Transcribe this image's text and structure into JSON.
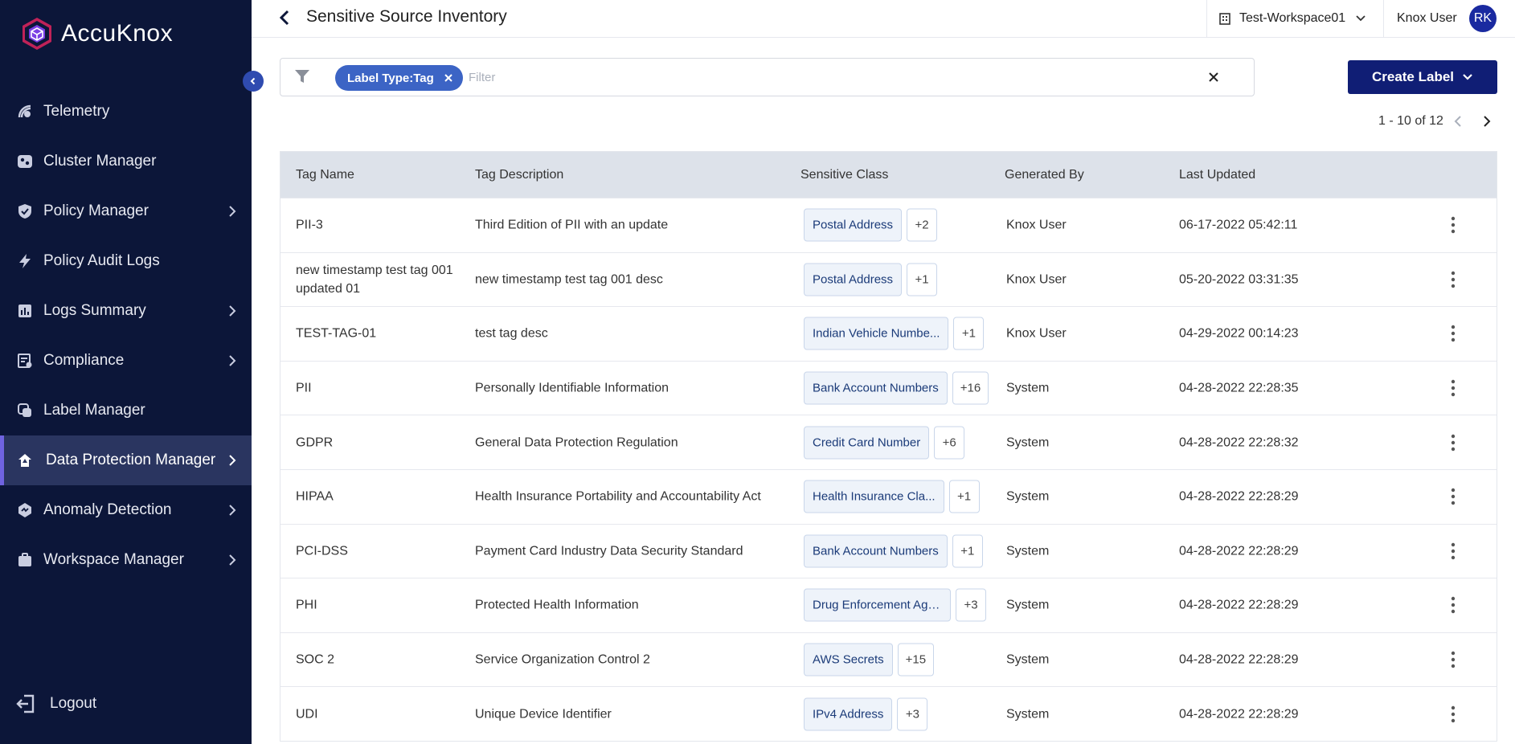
{
  "brand": {
    "name": "AccuKnox"
  },
  "sidebar": {
    "items": [
      {
        "label": "Telemetry",
        "icon": "telemetry-icon",
        "has_submenu": false,
        "active": false
      },
      {
        "label": "Cluster Manager",
        "icon": "cluster-icon",
        "has_submenu": false,
        "active": false
      },
      {
        "label": "Policy Manager",
        "icon": "shield-icon",
        "has_submenu": true,
        "active": false
      },
      {
        "label": "Policy Audit Logs",
        "icon": "bolt-icon",
        "has_submenu": false,
        "active": false
      },
      {
        "label": "Logs Summary",
        "icon": "bar-chart-icon",
        "has_submenu": true,
        "active": false
      },
      {
        "label": "Compliance",
        "icon": "compliance-icon",
        "has_submenu": true,
        "active": false
      },
      {
        "label": "Label Manager",
        "icon": "label-icon",
        "has_submenu": false,
        "active": false
      },
      {
        "label": "Data Protection Manager",
        "icon": "data-protection-icon",
        "has_submenu": true,
        "active": true
      },
      {
        "label": "Anomaly Detection",
        "icon": "anomaly-icon",
        "has_submenu": true,
        "active": false
      },
      {
        "label": "Workspace Manager",
        "icon": "briefcase-icon",
        "has_submenu": true,
        "active": false
      }
    ],
    "logout_label": "Logout"
  },
  "header": {
    "title": "Sensitive Source Inventory",
    "workspace": "Test-Workspace01",
    "user_name": "Knox User",
    "avatar_initials": "RK"
  },
  "filter": {
    "chip_label": "Label Type:Tag",
    "placeholder": "Filter",
    "value": ""
  },
  "create_button": {
    "label": "Create Label"
  },
  "pagination": {
    "summary": "1 - 10 of 12"
  },
  "table": {
    "columns": [
      "Tag Name",
      "Tag Description",
      "Sensitive Class",
      "Generated By",
      "Last Updated"
    ],
    "rows": [
      {
        "name": "PII-3",
        "description": "Third Edition of PII with an update",
        "class": "Postal Address",
        "more": "+2",
        "generated_by": "Knox User",
        "updated": "06-17-2022 05:42:11"
      },
      {
        "name": "new timestamp test tag 001 updated 01",
        "description": "new timestamp test tag 001 desc",
        "class": "Postal Address",
        "more": "+1",
        "generated_by": "Knox User",
        "updated": "05-20-2022 03:31:35"
      },
      {
        "name": "TEST-TAG-01",
        "description": "test tag desc",
        "class": "Indian Vehicle Numbe...",
        "more": "+1",
        "generated_by": "Knox User",
        "updated": "04-29-2022 00:14:23"
      },
      {
        "name": "PII",
        "description": "Personally Identifiable Information",
        "class": "Bank Account Numbers",
        "more": "+16",
        "generated_by": "System",
        "updated": "04-28-2022 22:28:35"
      },
      {
        "name": "GDPR",
        "description": "General Data Protection Regulation",
        "class": "Credit Card Number",
        "more": "+6",
        "generated_by": "System",
        "updated": "04-28-2022 22:28:32"
      },
      {
        "name": "HIPAA",
        "description": "Health Insurance Portability and Accountability Act",
        "class": "Health Insurance Cla...",
        "more": "+1",
        "generated_by": "System",
        "updated": "04-28-2022 22:28:29"
      },
      {
        "name": "PCI-DSS",
        "description": "Payment Card Industry Data Security Standard",
        "class": "Bank Account Numbers",
        "more": "+1",
        "generated_by": "System",
        "updated": "04-28-2022 22:28:29"
      },
      {
        "name": "PHI",
        "description": "Protected Health Information",
        "class": "Drug Enforcement Age...",
        "more": "+3",
        "generated_by": "System",
        "updated": "04-28-2022 22:28:29"
      },
      {
        "name": "SOC 2",
        "description": "Service Organization Control 2",
        "class": "AWS Secrets",
        "more": "+15",
        "generated_by": "System",
        "updated": "04-28-2022 22:28:29"
      },
      {
        "name": "UDI",
        "description": "Unique Device Identifier",
        "class": "IPv4 Address",
        "more": "+3",
        "generated_by": "System",
        "updated": "04-28-2022 22:28:29"
      }
    ]
  },
  "colors": {
    "sidebar_bg": "#0c1639",
    "primary_button": "#101e75",
    "chip_bg": "#3c64c5",
    "table_header_bg": "#dde2ea",
    "active_indicator": "#6f63e0"
  }
}
